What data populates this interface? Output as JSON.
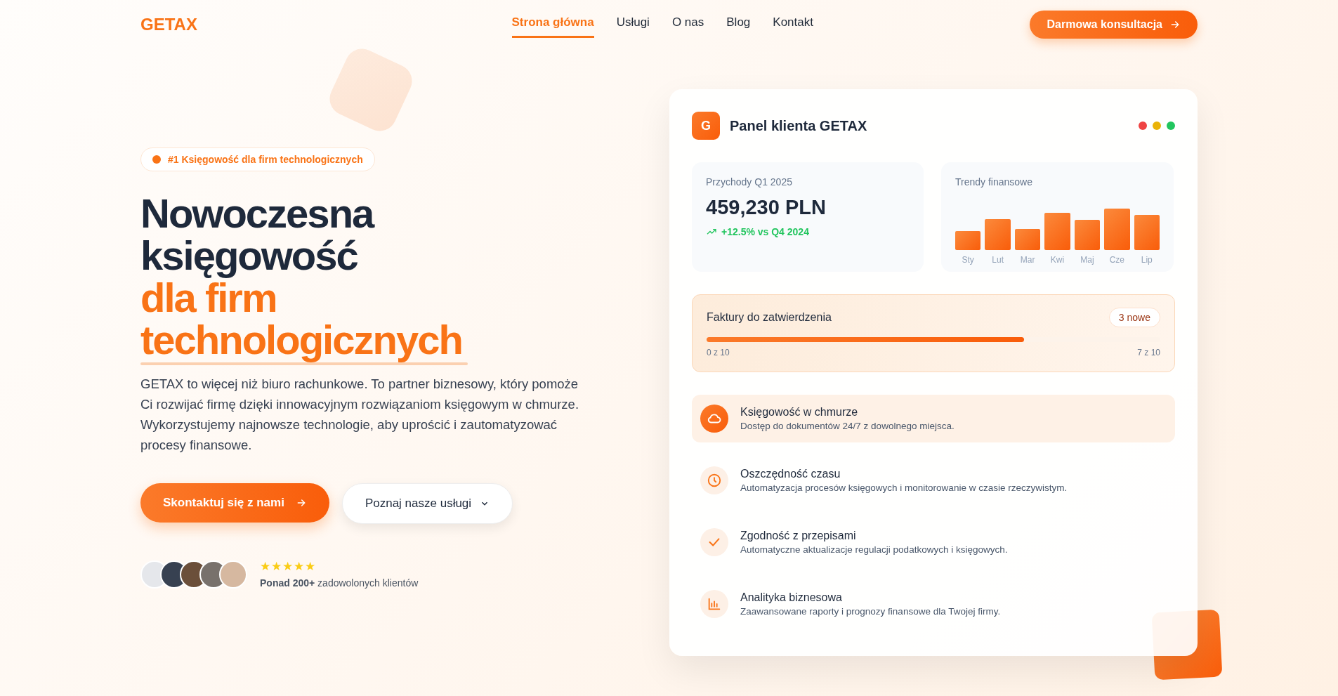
{
  "header": {
    "logo": "GETAX",
    "nav": [
      {
        "label": "Strona główna",
        "selected": true
      },
      {
        "label": "Usługi",
        "selected": false
      },
      {
        "label": "O nas",
        "selected": false
      },
      {
        "label": "Blog",
        "selected": false
      },
      {
        "label": "Kontakt",
        "selected": false
      }
    ],
    "cta": "Darmowa konsultacja"
  },
  "hero": {
    "badge": "#1 Księgowość dla firm technologicznych",
    "title_lines": [
      "Nowoczesna",
      "księgowość"
    ],
    "title_accent_lines": [
      "dla firm",
      "technologicznych"
    ],
    "description": "GETAX to więcej niż biuro rachunkowe. To partner biznesowy, który pomoże Ci rozwijać firmę dzięki innowacyjnym rozwiązaniom księgowym w chmurze. Wykorzystujemy najnowsze technologie, aby uprościć i zautomatyzować procesy finansowe.",
    "primary_button": "Skontaktuj się z nami",
    "secondary_button": "Poznaj nasze usługi",
    "rating": {
      "stars": 5,
      "text": "**Ponad 200+** zadowolonych klientów"
    }
  },
  "panel": {
    "logo_letter": "G",
    "title": "Panel klienta GETAX",
    "window_dots": [
      {
        "color": "#ef4444"
      },
      {
        "color": "#eab308"
      },
      {
        "color": "#22c55e"
      }
    ],
    "revenue": {
      "label": "Przychody Q1 2025",
      "value": "459,230 PLN",
      "change": "+12.5% vs Q4 2024"
    },
    "trends": {
      "label": "Trendy finansowe",
      "months": [
        "Sty",
        "Lut",
        "Mar",
        "Kwi",
        "Maj",
        "Cze",
        "Lip"
      ]
    },
    "invoices": {
      "title": "Faktury do zatwierdzenia",
      "badge": "3 nowe",
      "level": 0.7,
      "start": "0 z 10",
      "end": "7 z 10"
    },
    "features": [
      {
        "title": "Księgowość w chmurze",
        "text": "Dostęp do dokumentów 24/7 z dowolnego miejsca.",
        "selected": true
      },
      {
        "title": "Oszczędność czasu",
        "text": "Automatyzacja procesów księgowych i monitorowanie w czasie rzeczywistym.",
        "selected": false
      },
      {
        "title": "Zgodność z przepisami",
        "text": "Automatyczne aktualizacje regulacji podatkowych i księgowych.",
        "selected": false
      },
      {
        "title": "Analityka biznesowa",
        "text": "Zaawansowane raporty i prognozy finansowe dla Twojej firmy.",
        "selected": false
      }
    ]
  }
}
